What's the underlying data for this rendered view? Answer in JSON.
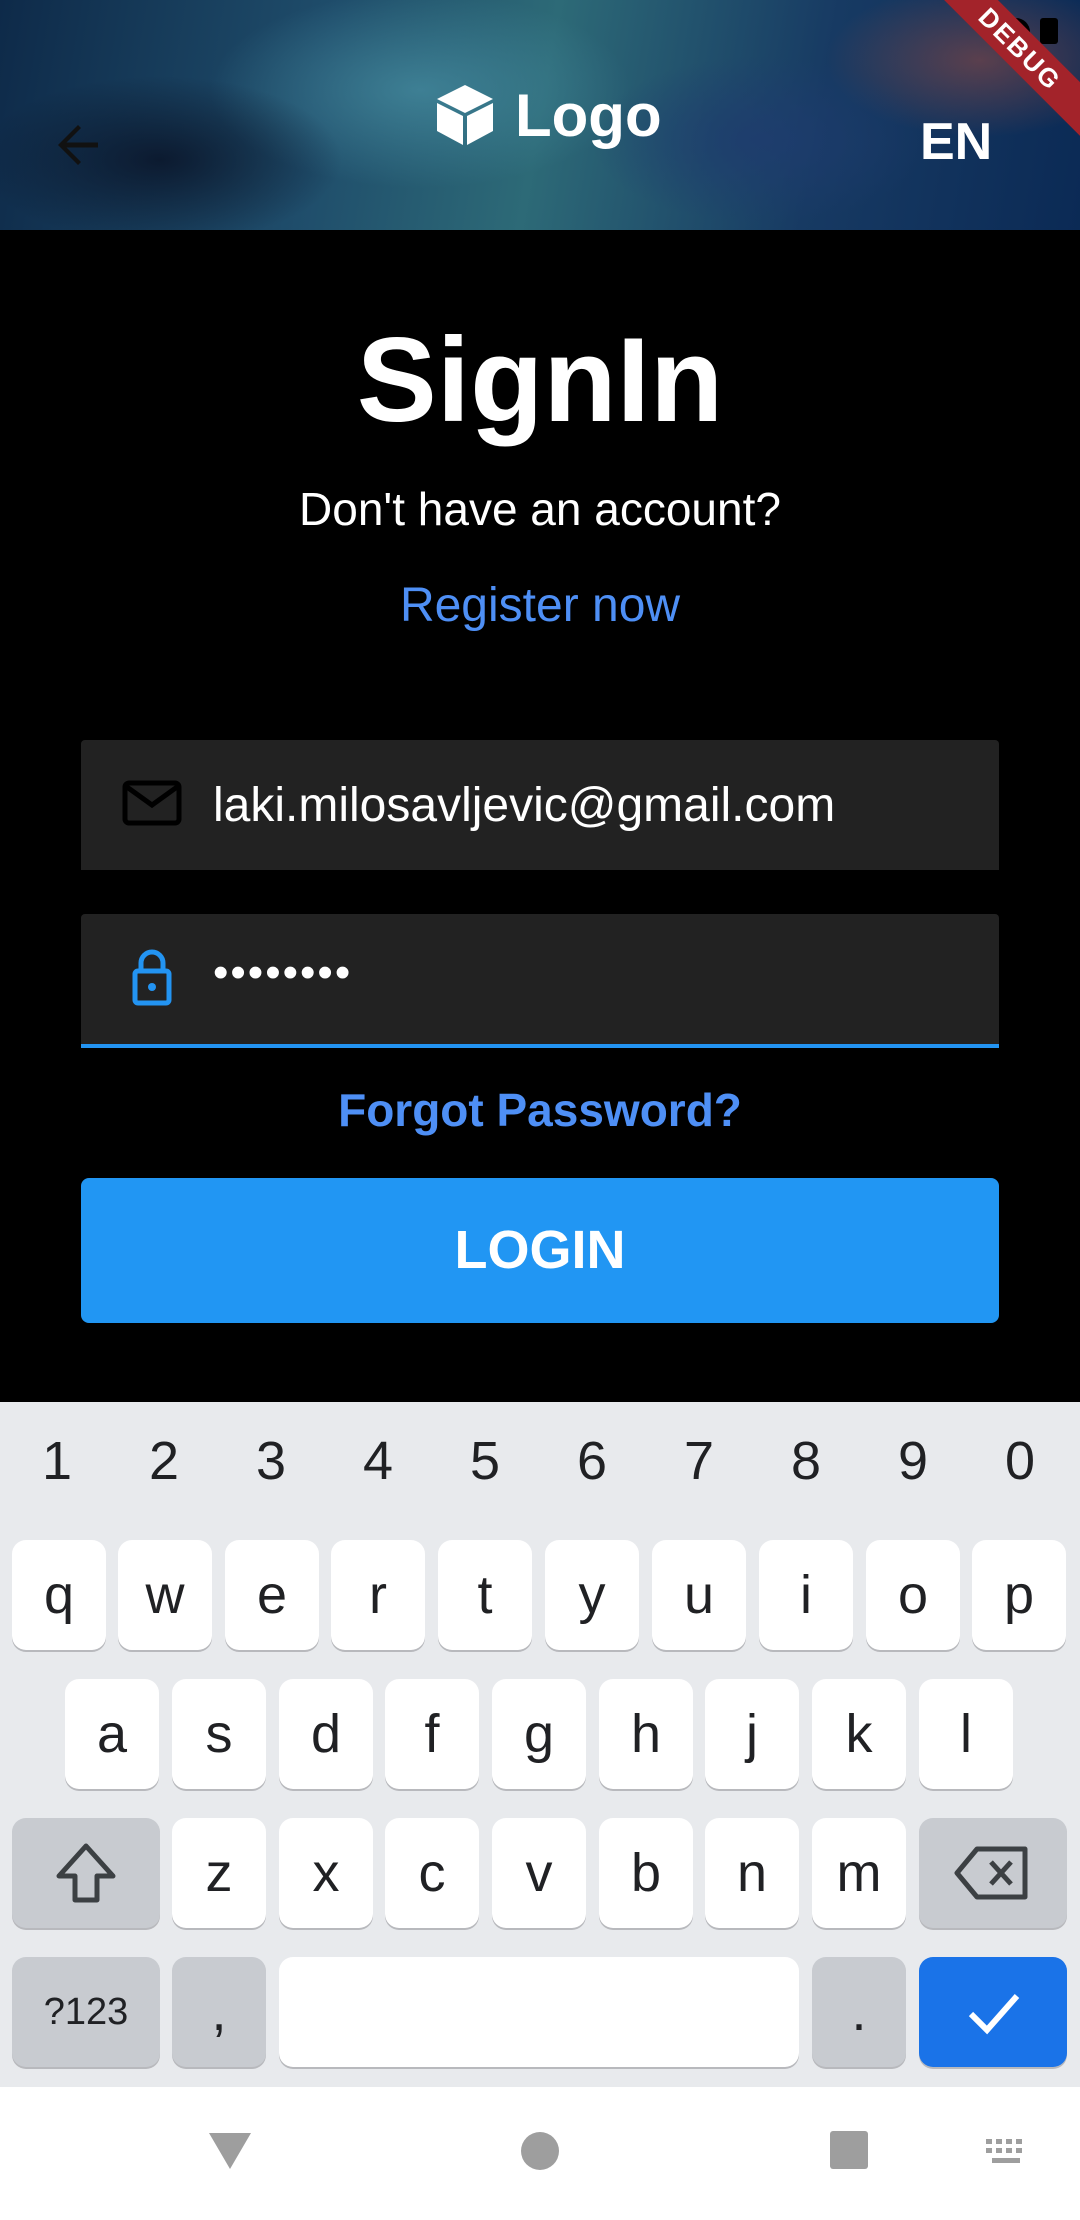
{
  "colors": {
    "accent": "#2196f3",
    "link": "#4e8ff5",
    "field_bg": "#222222",
    "debug": "#a3232a"
  },
  "header": {
    "logo_text": "Logo",
    "language": "EN",
    "debug_label": "DEBUG"
  },
  "signin": {
    "title": "SignIn",
    "subtitle": "Don't have an account?",
    "register_link": "Register now",
    "email_value": "laki.milosavljevic@gmail.com",
    "password_value": "••••••••",
    "forgot_link": "Forgot Password?",
    "login_button": "LOGIN"
  },
  "keyboard": {
    "number_row": [
      "1",
      "2",
      "3",
      "4",
      "5",
      "6",
      "7",
      "8",
      "9",
      "0"
    ],
    "row1": [
      "q",
      "w",
      "e",
      "r",
      "t",
      "y",
      "u",
      "i",
      "o",
      "p"
    ],
    "row2": [
      "a",
      "s",
      "d",
      "f",
      "g",
      "h",
      "j",
      "k",
      "l"
    ],
    "row3": [
      "z",
      "x",
      "c",
      "v",
      "b",
      "n",
      "m"
    ],
    "symbols_key": "?123",
    "comma_key": ",",
    "period_key": "."
  },
  "icons": {
    "back": "arrow-left-icon",
    "logo": "cube-icon",
    "email": "mail-icon",
    "password": "lock-icon",
    "shift": "shift-icon",
    "backspace": "backspace-icon",
    "enter": "checkmark-icon",
    "nav_back": "triangle-back-icon",
    "nav_home": "circle-home-icon",
    "nav_recents": "square-recents-icon",
    "nav_keyboard": "keyboard-icon"
  }
}
